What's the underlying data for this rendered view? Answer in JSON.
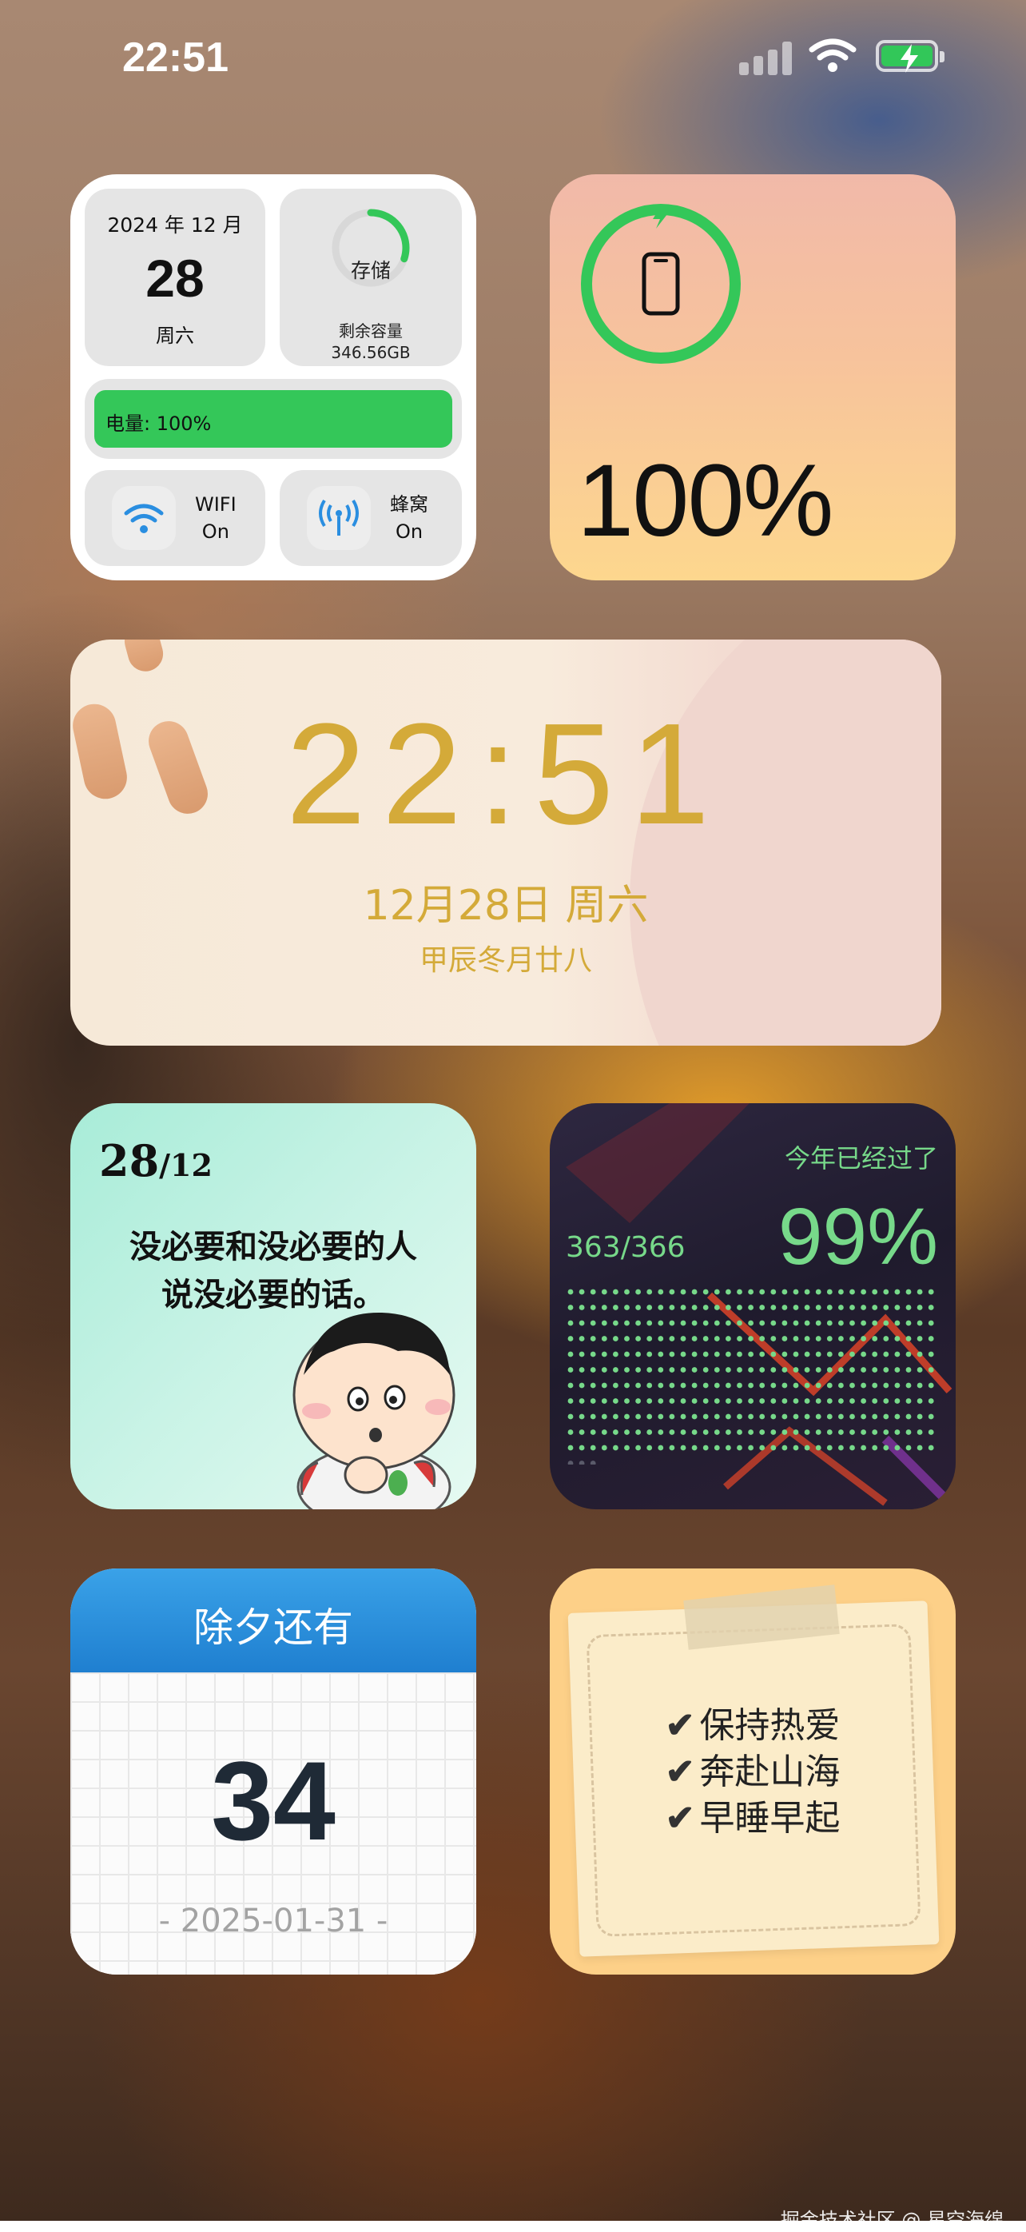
{
  "status_bar": {
    "time": "22:51"
  },
  "system_widget": {
    "year_month": "2024 年 12 月",
    "day": "28",
    "weekday": "周六",
    "storage_label": "存储",
    "storage_remaining_label": "剩余容量",
    "storage_capacity": "346.56GB",
    "storage_used_fraction": 0.3,
    "battery_label": "电量: 100%",
    "wifi_label": "WIFI",
    "wifi_state": "On",
    "cellular_label": "蜂窝",
    "cellular_state": "On"
  },
  "battery_widget": {
    "percent": "100%",
    "level": 1.0
  },
  "clock_widget": {
    "time": "22:51",
    "date": "12月28日 周六",
    "lunar": "甲辰冬月廿八"
  },
  "quote_widget": {
    "day": "28",
    "month": "/12",
    "line1": "没必要和没必要的人",
    "line2": "说没必要的话。"
  },
  "year_widget": {
    "header": "今年已经过了",
    "count": "363/366",
    "percent": "99%"
  },
  "countdown_widget": {
    "title": "除夕还有",
    "days": "34",
    "date": "- 2025-01-31 -"
  },
  "note_widget": {
    "items": [
      "保持热爱",
      "奔赴山海",
      "早睡早起"
    ],
    "check": "✔"
  },
  "watermark": "掘金技术社区 @ 星空海绵",
  "colors": {
    "green": "#34c759",
    "gold": "#d4aa39",
    "progress_green": "#77d98a",
    "blue": "#2a8ee0"
  }
}
